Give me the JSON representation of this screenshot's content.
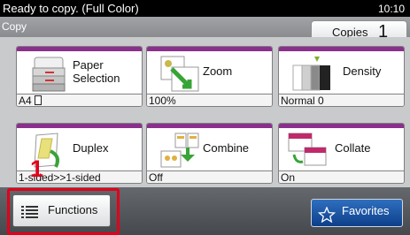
{
  "status": {
    "message": "Ready to copy. (Full Color)",
    "clock": "10:10"
  },
  "title": "Copy",
  "copies": {
    "label": "Copies",
    "count": "1"
  },
  "tiles": [
    {
      "label_line1": "Paper",
      "label_line2": "Selection",
      "value": "A4",
      "icon": "paper-stack-icon"
    },
    {
      "label_line1": "Zoom",
      "value": "100%",
      "icon": "zoom-icon"
    },
    {
      "label_line1": "Density",
      "value": "Normal 0",
      "icon": "density-icon"
    },
    {
      "label_line1": "Duplex",
      "value": "1-sided>>1-sided",
      "icon": "duplex-icon"
    },
    {
      "label_line1": "Combine",
      "value": "Off",
      "icon": "combine-icon"
    },
    {
      "label_line1": "Collate",
      "value": "On",
      "icon": "collate-icon"
    }
  ],
  "functions_button": {
    "label": "Functions",
    "icon": "list-icon"
  },
  "favorites_button": {
    "label": "Favorites",
    "icon": "star-icon"
  },
  "step_marker": "1",
  "colors": {
    "tile_accent": "#8b2f8c",
    "highlight": "#e2001a",
    "favorites": "#1b55a5"
  }
}
